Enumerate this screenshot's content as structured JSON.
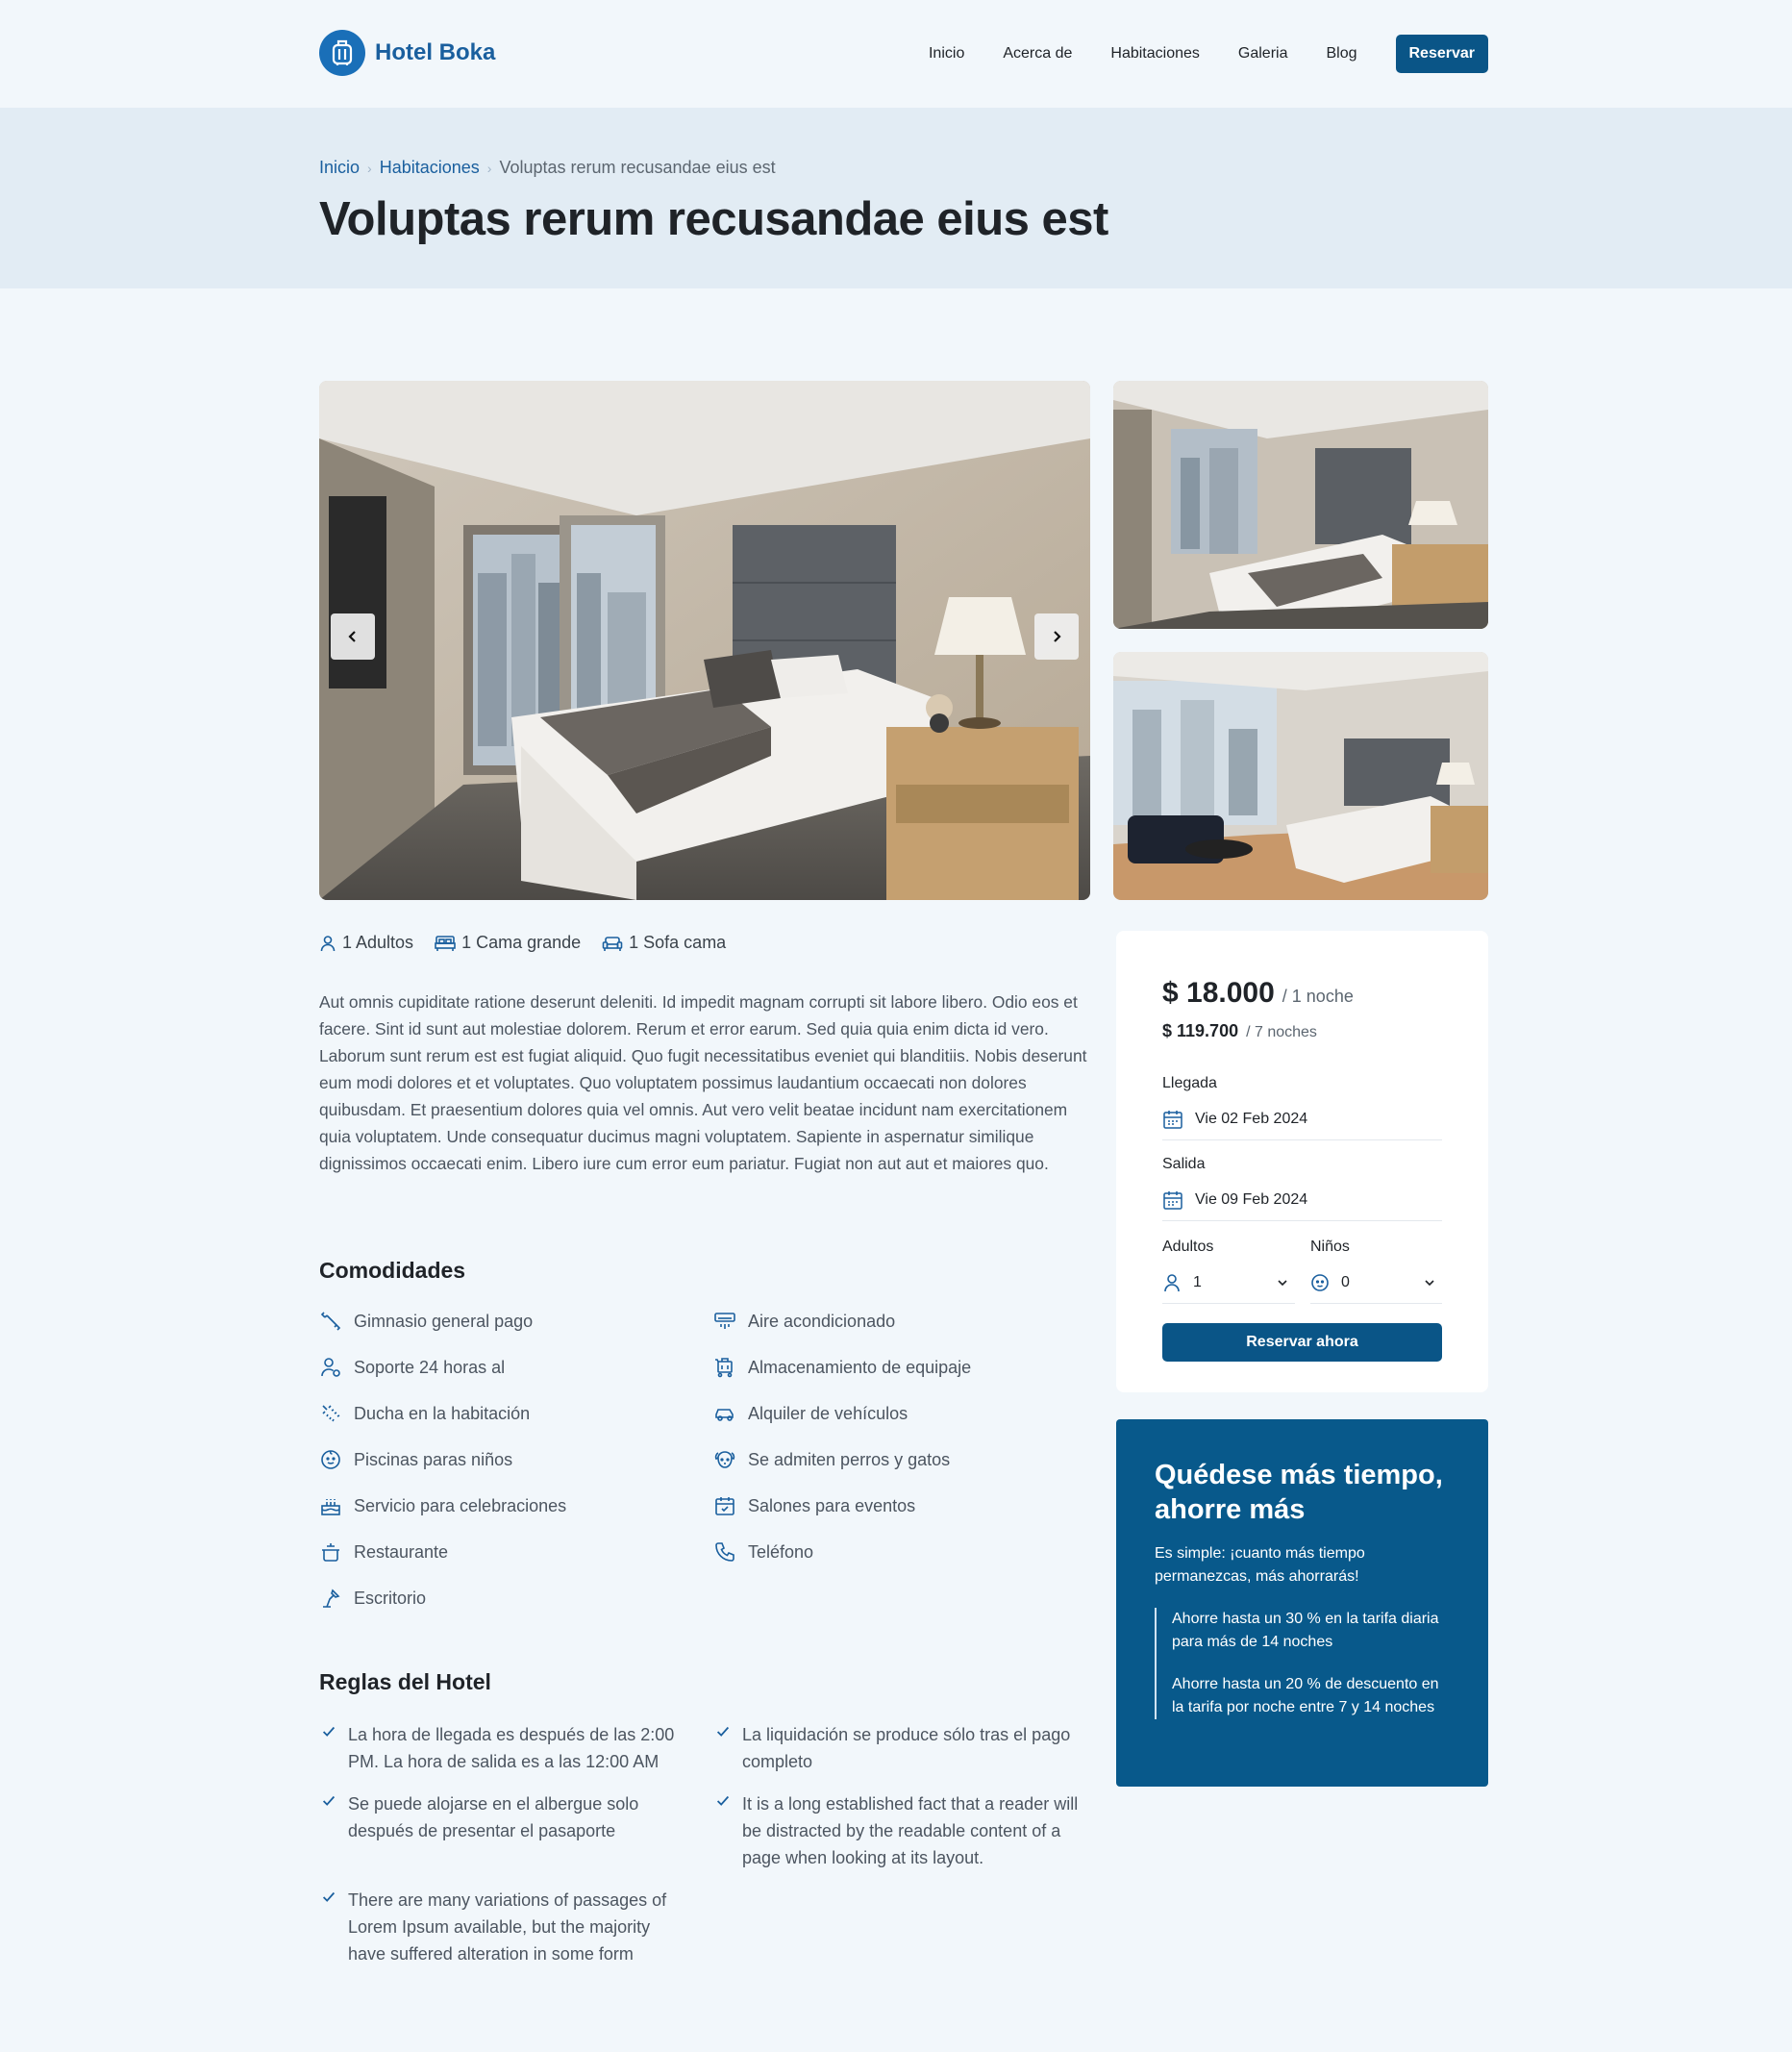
{
  "brand": {
    "name": "Hotel Boka",
    "color": "#1a6fb8"
  },
  "nav": {
    "items": [
      "Inicio",
      "Acerca de",
      "Habitaciones",
      "Galeria",
      "Blog"
    ],
    "cta": "Reservar"
  },
  "breadcrumb": {
    "home": "Inicio",
    "section": "Habitaciones",
    "current": "Voluptas rerum recusandae eius est"
  },
  "page_title": "Voluptas rerum recusandae eius est",
  "gallery": {
    "prev_icon": "chevron-left-icon",
    "next_icon": "chevron-right-icon"
  },
  "capacity": {
    "adults": "1 Adultos",
    "bed": "1 Cama grande",
    "sofa": "1 Sofa cama"
  },
  "description": "Aut omnis cupiditate ratione deserunt deleniti. Id impedit magnam corrupti sit labore libero. Odio eos et facere. Sint id sunt aut molestiae dolorem. Rerum et error earum. Sed quia quia enim dicta id vero. Laborum sunt rerum est est fugiat aliquid. Quo fugit necessitatibus eveniet qui blanditiis. Nobis deserunt eum modi dolores et et voluptates. Quo voluptatem possimus laudantium occaecati non dolores quibusdam. Et praesentium dolores quia vel omnis. Aut vero velit beatae incidunt nam exercitationem quia voluptatem. Unde consequatur ducimus magni voluptatem. Sapiente in aspernatur similique dignissimos occaecati enim. Libero iure cum error eum pariatur. Fugiat non aut aut et maiores quo.",
  "amenities": {
    "title": "Comodidades",
    "items": [
      {
        "label": "Gimnasio general pago",
        "icon": "dumbbell-icon"
      },
      {
        "label": "Aire acondicionado",
        "icon": "air-conditioner-icon"
      },
      {
        "label": "Soporte 24 horas al",
        "icon": "support-user-icon"
      },
      {
        "label": "Almacenamiento de equipaje",
        "icon": "luggage-cart-icon"
      },
      {
        "label": "Ducha en la habitación",
        "icon": "shower-icon"
      },
      {
        "label": "Alquiler de vehículos",
        "icon": "car-icon"
      },
      {
        "label": "Piscinas paras niños",
        "icon": "baby-face-icon"
      },
      {
        "label": "Se admiten perros y gatos",
        "icon": "pet-icon"
      },
      {
        "label": "Servicio para celebraciones",
        "icon": "cake-icon"
      },
      {
        "label": "Salones para eventos",
        "icon": "calendar-event-icon"
      },
      {
        "label": "Restaurante",
        "icon": "cooking-pot-icon"
      },
      {
        "label": "Teléfono",
        "icon": "phone-icon"
      },
      {
        "label": "Escritorio",
        "icon": "desk-lamp-icon"
      }
    ]
  },
  "rules": {
    "title": "Reglas del Hotel",
    "items": [
      "La hora de llegada es después de las 2:00 PM. La hora de salida es a las 12:00 AM",
      "La liquidación se produce sólo tras el pago completo",
      "Se puede alojarse en el albergue solo después de presentar el pasaporte",
      "It is a long established fact that a reader will be distracted by the readable content of a page when looking at its layout.",
      "There are many variations of passages of Lorem Ipsum available, but the majority have suffered alteration in some form"
    ]
  },
  "booking": {
    "price": "$ 18.000",
    "price_unit": "/ 1 noche",
    "total": "$ 119.700",
    "total_unit": "/ 7 noches",
    "checkin_label": "Llegada",
    "checkin_value": "Vie 02 Feb 2024",
    "checkout_label": "Salida",
    "checkout_value": "Vie 09 Feb 2024",
    "adults_label": "Adultos",
    "adults_value": "1",
    "children_label": "Niños",
    "children_value": "0",
    "button": "Reservar ahora"
  },
  "promo": {
    "title": "Quédese más tiempo, ahorre más",
    "text": "Es simple: ¡cuanto más tiempo permanezcas, más ahorrarás!",
    "items": [
      "Ahorre hasta un 30 % en la tarifa diaria para más de 14 noches",
      "Ahorre hasta un 20 % de descuento en la tarifa por noche entre 7 y 14 noches"
    ]
  },
  "colors": {
    "primary": "#0a5587",
    "link": "#1a5f9e",
    "promo_bg": "#08598b",
    "page_bg": "#f2f7fb"
  }
}
